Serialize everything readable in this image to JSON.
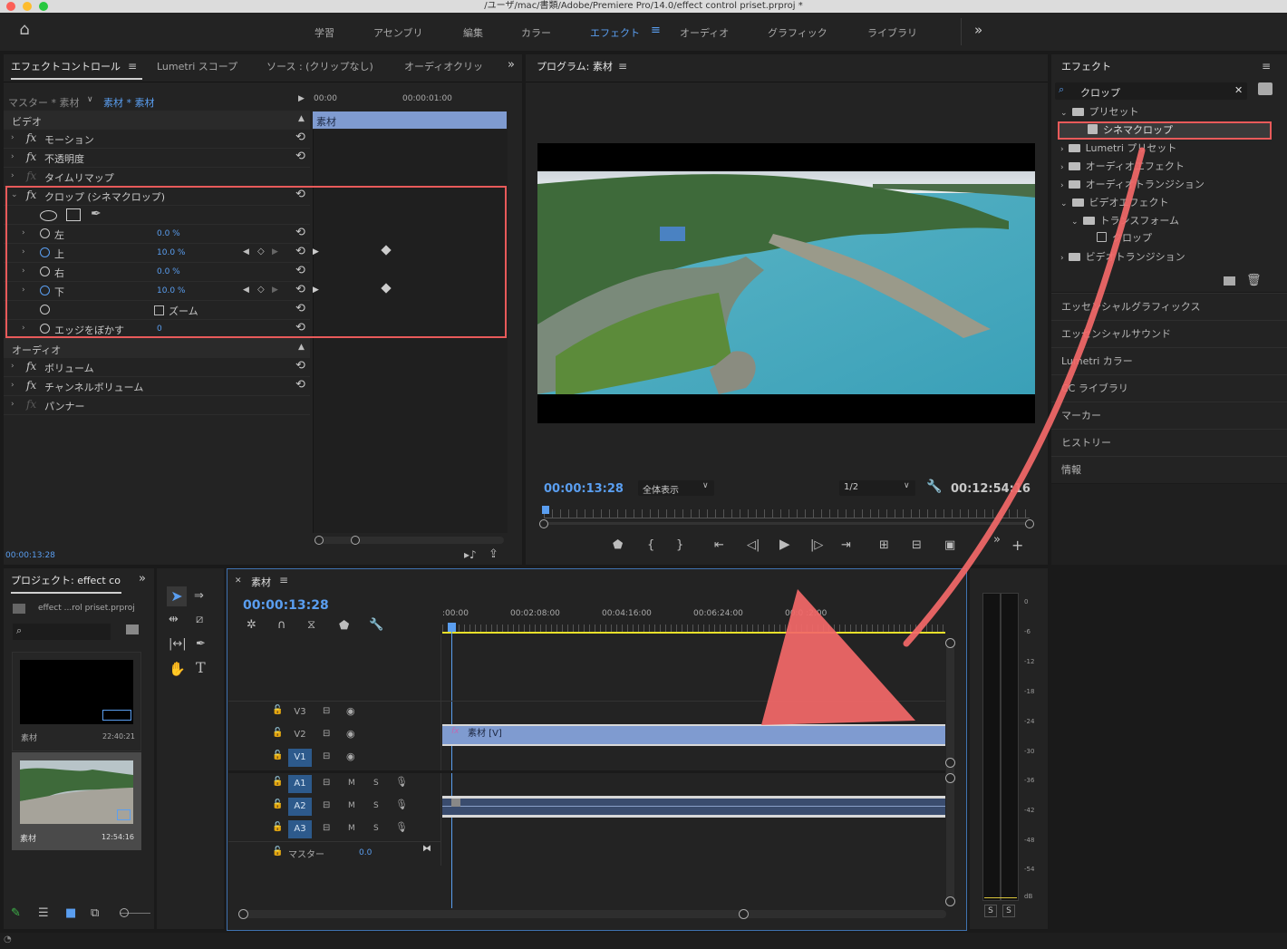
{
  "window": {
    "title": "/ユーザ/mac/書類/Adobe/Premiere Pro/14.0/effect control priset.prproj *"
  },
  "workspaces": {
    "items": [
      "学習",
      "アセンブリ",
      "編集",
      "カラー",
      "エフェクト",
      "オーディオ",
      "グラフィック",
      "ライブラリ"
    ],
    "more": "»"
  },
  "effect_controls": {
    "tabs": [
      "エフェクトコントロール",
      "Lumetri スコープ",
      "ソース : (クリップなし)",
      "オーディオクリッ"
    ],
    "master": "マスター * 素材",
    "clip": "素材 * 素材",
    "ruler": [
      "00:00",
      "00:00:01:00"
    ],
    "clip_bar": "素材",
    "video_header": "ビデオ",
    "rows": [
      "モーション",
      "不透明度",
      "タイムリマップ",
      "クロップ (シネマクロップ)"
    ],
    "params": [
      {
        "label": "左",
        "value": "0.0 %"
      },
      {
        "label": "上",
        "value": "10.0 %"
      },
      {
        "label": "右",
        "value": "0.0 %"
      },
      {
        "label": "下",
        "value": "10.0 %"
      },
      {
        "label": "ズーム",
        "value": ""
      },
      {
        "label": "エッジをぼかす",
        "value": "0"
      }
    ],
    "audio_header": "オーディオ",
    "audio_rows": [
      "ボリューム",
      "チャンネルボリューム",
      "パンナー"
    ],
    "timecode": "00:00:13:28"
  },
  "program": {
    "title": "プログラム: 素材",
    "timecode": "00:00:13:28",
    "fit": "全体表示",
    "resolution": "1/2",
    "duration": "00:12:54:16"
  },
  "effects": {
    "title": "エフェクト",
    "search": "クロップ",
    "tree": [
      {
        "label": "プリセット",
        "level": 0,
        "open": true
      },
      {
        "label": "シネマクロップ",
        "level": 1,
        "selected": true
      },
      {
        "label": "Lumetri プリセット",
        "level": 0
      },
      {
        "label": "オーディオエフェクト",
        "level": 0
      },
      {
        "label": "オーディオトランジション",
        "level": 0
      },
      {
        "label": "ビデオエフェクト",
        "level": 0,
        "open": true
      },
      {
        "label": "トランスフォーム",
        "level": 1,
        "open": true
      },
      {
        "label": "クロップ",
        "level": 2
      },
      {
        "label": "ビデオトランジション",
        "level": 0
      }
    ],
    "sections": [
      "エッセンシャルグラフィックス",
      "エッセンシャルサウンド",
      "Lumetri カラー",
      "CC ライブラリ",
      "マーカー",
      "ヒストリー",
      "情報"
    ]
  },
  "project": {
    "title": "プロジェクト: effect cont",
    "file": "effect ...rol priset.prproj",
    "items": [
      {
        "name": "素材",
        "duration": "22:40:21"
      },
      {
        "name": "素材",
        "duration": "12:54:16"
      }
    ]
  },
  "timeline": {
    "title": "素材",
    "timecode": "00:00:13:28",
    "ruler": [
      ":00:00",
      "00:02:08:00",
      "00:04:16:00",
      "00:06:24:00",
      "00:0  :2:00"
    ],
    "video_tracks": [
      "V3",
      "V2",
      "V1"
    ],
    "audio_tracks": [
      "A1",
      "A2",
      "A3"
    ],
    "master_label": "マスター",
    "master_value": "0.0",
    "clip_label": "素材 [V]"
  },
  "meter": {
    "scale": [
      "0",
      "-6",
      "-12",
      "-18",
      "-24",
      "-30",
      "-36",
      "-42",
      "-48",
      "-54",
      "dB"
    ],
    "solo": [
      "S",
      "S"
    ]
  },
  "colors": {
    "accent": "#5a9ef0",
    "highlight": "#e85a5a",
    "clip": "#7f9bd0",
    "arrow": "#f26868"
  }
}
